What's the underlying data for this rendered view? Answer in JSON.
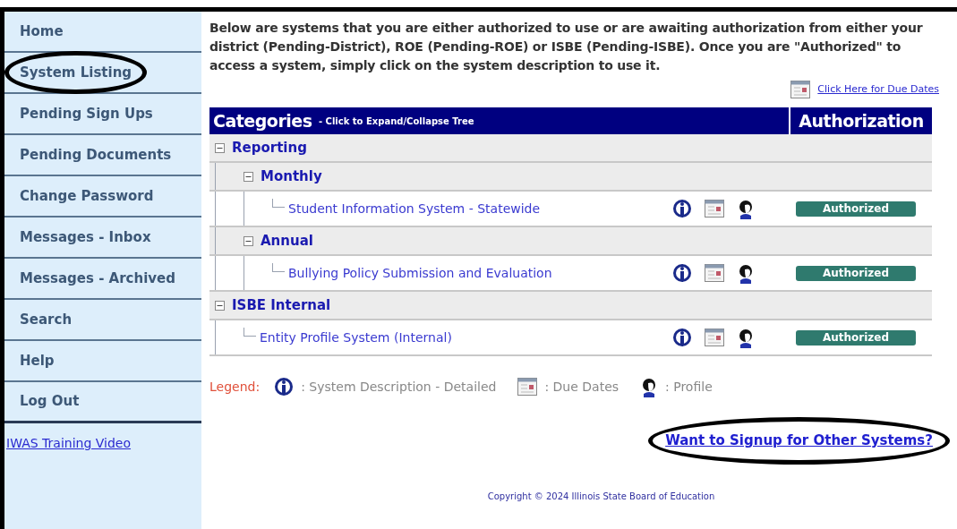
{
  "nav": {
    "items": [
      {
        "label": "Home",
        "circled": false
      },
      {
        "label": "System Listing",
        "circled": true
      },
      {
        "label": "Pending Sign Ups",
        "circled": false
      },
      {
        "label": "Pending Documents",
        "circled": false
      },
      {
        "label": "Change Password",
        "circled": false
      },
      {
        "label": "Messages - Inbox",
        "circled": false
      },
      {
        "label": "Messages - Archived",
        "circled": false
      },
      {
        "label": "Search",
        "circled": false
      },
      {
        "label": "Help",
        "circled": false
      },
      {
        "label": "Log Out",
        "circled": false
      }
    ],
    "video_link": "IWAS Training Video"
  },
  "intro": "Below are systems that you are either authorized to use or are awaiting authorization from either your district (Pending-District), ROE (Pending-ROE) or ISBE (Pending-ISBE). Once you are \"Authorized\" to access a system, simply click on the system description to use it.",
  "due_dates_link": "Click Here for Due Dates",
  "table": {
    "header_title": "Categories",
    "header_hint": " - Click to Expand/Collapse Tree",
    "header_auth": "Authorization",
    "tree": [
      {
        "kind": "category",
        "label": "Reporting",
        "expanded": true,
        "children": [
          {
            "kind": "category",
            "label": "Monthly",
            "expanded": true,
            "children": [
              {
                "kind": "system",
                "label": "Student Information System - Statewide",
                "authorization": "Authorized"
              }
            ]
          },
          {
            "kind": "category",
            "label": "Annual",
            "expanded": true,
            "children": [
              {
                "kind": "system",
                "label": "Bullying Policy Submission and Evaluation",
                "authorization": "Authorized"
              }
            ]
          }
        ]
      },
      {
        "kind": "category",
        "label": "ISBE Internal",
        "expanded": true,
        "children": [
          {
            "kind": "system",
            "label": "Entity Profile System (Internal)",
            "authorization": "Authorized"
          }
        ]
      }
    ]
  },
  "legend": {
    "title": "Legend:",
    "info": ": System Description - Detailed",
    "due": ": Due Dates",
    "profile": ": Profile"
  },
  "signup_link": {
    "label": "Want to Signup for Other Systems?",
    "circled": true
  },
  "copyright": "Copyright © 2024 Illinois State Board of Education"
}
